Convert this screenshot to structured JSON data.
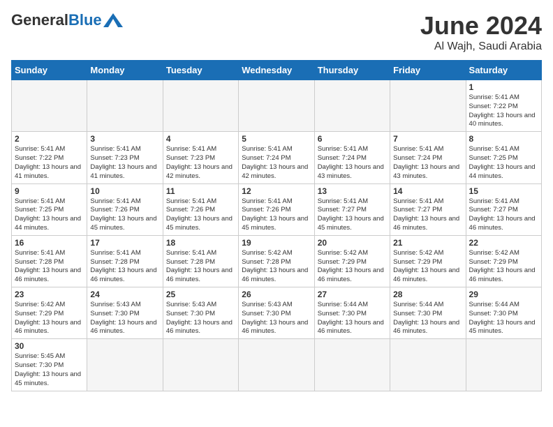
{
  "header": {
    "logo_general": "General",
    "logo_blue": "Blue",
    "month_title": "June 2024",
    "location": "Al Wajh, Saudi Arabia"
  },
  "weekdays": [
    "Sunday",
    "Monday",
    "Tuesday",
    "Wednesday",
    "Thursday",
    "Friday",
    "Saturday"
  ],
  "weeks": [
    [
      {
        "day": "",
        "info": ""
      },
      {
        "day": "",
        "info": ""
      },
      {
        "day": "",
        "info": ""
      },
      {
        "day": "",
        "info": ""
      },
      {
        "day": "",
        "info": ""
      },
      {
        "day": "",
        "info": ""
      },
      {
        "day": "1",
        "info": "Sunrise: 5:41 AM\nSunset: 7:22 PM\nDaylight: 13 hours\nand 40 minutes."
      }
    ],
    [
      {
        "day": "2",
        "info": "Sunrise: 5:41 AM\nSunset: 7:22 PM\nDaylight: 13 hours\nand 41 minutes."
      },
      {
        "day": "3",
        "info": "Sunrise: 5:41 AM\nSunset: 7:23 PM\nDaylight: 13 hours\nand 41 minutes."
      },
      {
        "day": "4",
        "info": "Sunrise: 5:41 AM\nSunset: 7:23 PM\nDaylight: 13 hours\nand 42 minutes."
      },
      {
        "day": "5",
        "info": "Sunrise: 5:41 AM\nSunset: 7:24 PM\nDaylight: 13 hours\nand 42 minutes."
      },
      {
        "day": "6",
        "info": "Sunrise: 5:41 AM\nSunset: 7:24 PM\nDaylight: 13 hours\nand 43 minutes."
      },
      {
        "day": "7",
        "info": "Sunrise: 5:41 AM\nSunset: 7:24 PM\nDaylight: 13 hours\nand 43 minutes."
      },
      {
        "day": "8",
        "info": "Sunrise: 5:41 AM\nSunset: 7:25 PM\nDaylight: 13 hours\nand 44 minutes."
      }
    ],
    [
      {
        "day": "9",
        "info": "Sunrise: 5:41 AM\nSunset: 7:25 PM\nDaylight: 13 hours\nand 44 minutes."
      },
      {
        "day": "10",
        "info": "Sunrise: 5:41 AM\nSunset: 7:26 PM\nDaylight: 13 hours\nand 45 minutes."
      },
      {
        "day": "11",
        "info": "Sunrise: 5:41 AM\nSunset: 7:26 PM\nDaylight: 13 hours\nand 45 minutes."
      },
      {
        "day": "12",
        "info": "Sunrise: 5:41 AM\nSunset: 7:26 PM\nDaylight: 13 hours\nand 45 minutes."
      },
      {
        "day": "13",
        "info": "Sunrise: 5:41 AM\nSunset: 7:27 PM\nDaylight: 13 hours\nand 45 minutes."
      },
      {
        "day": "14",
        "info": "Sunrise: 5:41 AM\nSunset: 7:27 PM\nDaylight: 13 hours\nand 46 minutes."
      },
      {
        "day": "15",
        "info": "Sunrise: 5:41 AM\nSunset: 7:27 PM\nDaylight: 13 hours\nand 46 minutes."
      }
    ],
    [
      {
        "day": "16",
        "info": "Sunrise: 5:41 AM\nSunset: 7:28 PM\nDaylight: 13 hours\nand 46 minutes."
      },
      {
        "day": "17",
        "info": "Sunrise: 5:41 AM\nSunset: 7:28 PM\nDaylight: 13 hours\nand 46 minutes."
      },
      {
        "day": "18",
        "info": "Sunrise: 5:41 AM\nSunset: 7:28 PM\nDaylight: 13 hours\nand 46 minutes."
      },
      {
        "day": "19",
        "info": "Sunrise: 5:42 AM\nSunset: 7:28 PM\nDaylight: 13 hours\nand 46 minutes."
      },
      {
        "day": "20",
        "info": "Sunrise: 5:42 AM\nSunset: 7:29 PM\nDaylight: 13 hours\nand 46 minutes."
      },
      {
        "day": "21",
        "info": "Sunrise: 5:42 AM\nSunset: 7:29 PM\nDaylight: 13 hours\nand 46 minutes."
      },
      {
        "day": "22",
        "info": "Sunrise: 5:42 AM\nSunset: 7:29 PM\nDaylight: 13 hours\nand 46 minutes."
      }
    ],
    [
      {
        "day": "23",
        "info": "Sunrise: 5:42 AM\nSunset: 7:29 PM\nDaylight: 13 hours\nand 46 minutes."
      },
      {
        "day": "24",
        "info": "Sunrise: 5:43 AM\nSunset: 7:30 PM\nDaylight: 13 hours\nand 46 minutes."
      },
      {
        "day": "25",
        "info": "Sunrise: 5:43 AM\nSunset: 7:30 PM\nDaylight: 13 hours\nand 46 minutes."
      },
      {
        "day": "26",
        "info": "Sunrise: 5:43 AM\nSunset: 7:30 PM\nDaylight: 13 hours\nand 46 minutes."
      },
      {
        "day": "27",
        "info": "Sunrise: 5:44 AM\nSunset: 7:30 PM\nDaylight: 13 hours\nand 46 minutes."
      },
      {
        "day": "28",
        "info": "Sunrise: 5:44 AM\nSunset: 7:30 PM\nDaylight: 13 hours\nand 46 minutes."
      },
      {
        "day": "29",
        "info": "Sunrise: 5:44 AM\nSunset: 7:30 PM\nDaylight: 13 hours\nand 45 minutes."
      }
    ],
    [
      {
        "day": "30",
        "info": "Sunrise: 5:45 AM\nSunset: 7:30 PM\nDaylight: 13 hours\nand 45 minutes."
      },
      {
        "day": "",
        "info": ""
      },
      {
        "day": "",
        "info": ""
      },
      {
        "day": "",
        "info": ""
      },
      {
        "day": "",
        "info": ""
      },
      {
        "day": "",
        "info": ""
      },
      {
        "day": "",
        "info": ""
      }
    ]
  ]
}
